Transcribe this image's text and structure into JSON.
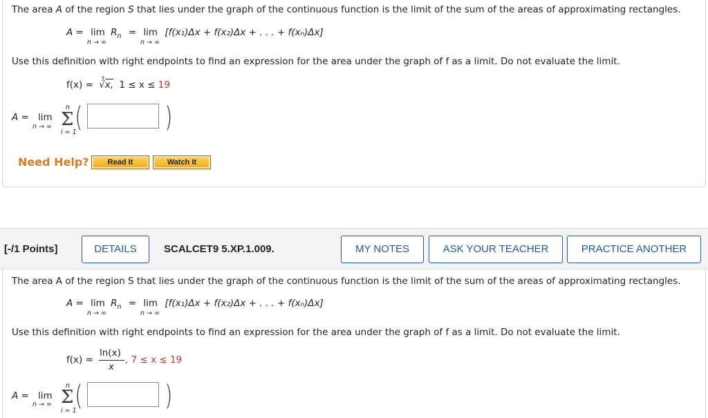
{
  "problem1": {
    "intro_a": "The area ",
    "intro_A": "A",
    "intro_b": " of the region ",
    "intro_S": "S",
    "intro_c": " that lies under the graph of the continuous function is the limit of the sum of the areas of approximating rectangles.",
    "formula_lhs": "A =",
    "lim": "lim",
    "n_to_inf": "n → ∞",
    "Rn": "R",
    "Rn_sub": "n",
    "eq": "=",
    "bracket_sum": "[f(x₁)Δx + f(x₂)Δx + . . . + f(xₙ)Δx]",
    "instruction": "Use this definition with right endpoints to find an expression for the area under the graph of f as a limit. Do not evaluate the limit.",
    "fx_label": "f(x) =",
    "root_index": "7",
    "radicand": "x,",
    "domain_start": "1",
    "domain_mid": " ≤ x ≤ ",
    "domain_end": "19",
    "answer_lhs": "A =",
    "sum_top": "n",
    "sum_bottom": "i = 1",
    "answer_value": ""
  },
  "help": {
    "label": "Need Help?",
    "read_it": "Read It",
    "watch_it": "Watch It"
  },
  "problem2_header": {
    "points": "[-/1 Points]",
    "details": "DETAILS",
    "code": "SCALCET9 5.XP.1.009.",
    "my_notes": "MY NOTES",
    "ask_teacher": "ASK YOUR TEACHER",
    "practice": "PRACTICE ANOTHER"
  },
  "problem2": {
    "intro": "The area A of the region S that lies under the graph of the continuous function is the limit of the sum of the areas of approximating rectangles.",
    "formula_lhs": "A =",
    "lim": "lim",
    "n_to_inf": "n → ∞",
    "Rn": "R",
    "Rn_sub": "n",
    "eq": "=",
    "bracket_sum": "[f(x₁)Δx + f(x₂)Δx + . . . + f(xₙ)Δx]",
    "instruction": "Use this definition with right endpoints to find an expression for the area under the graph of f as a limit. Do not evaluate the limit.",
    "fx_label": "f(x) =",
    "numerator": "ln(x)",
    "denominator": "x",
    "domain": ", 7 ≤ x ≤ 19",
    "answer_lhs": "A =",
    "sum_top": "n",
    "sum_bottom": "i = 1",
    "answer_value": ""
  },
  "colors": {
    "accent_blue": "#1e5a9c",
    "help_orange": "#e07a1f",
    "domain_red": "#c0392b"
  }
}
